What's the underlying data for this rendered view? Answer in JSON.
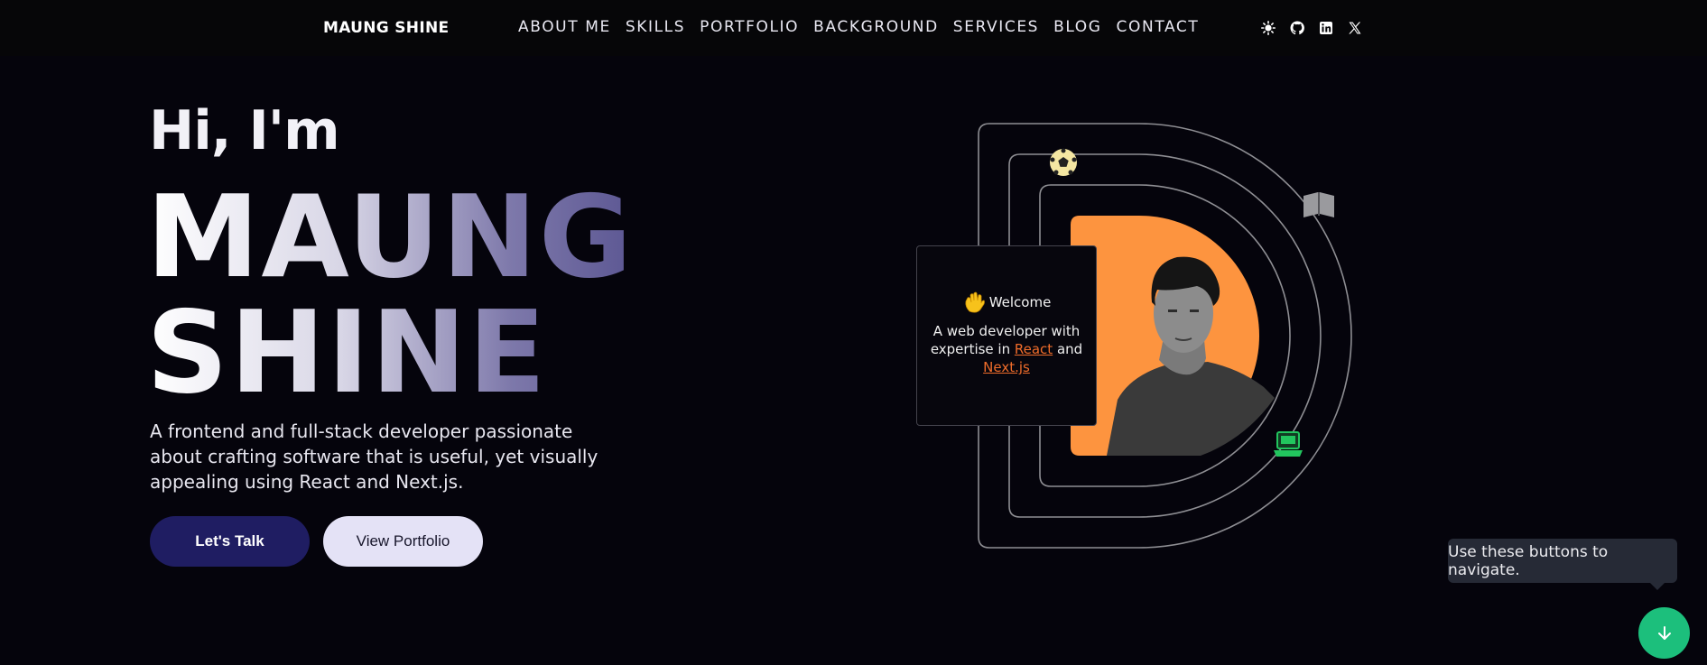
{
  "nav": {
    "brand": "MAUNG SHINE",
    "links": [
      {
        "label": "ABOUT ME"
      },
      {
        "label": "SKILLS"
      },
      {
        "label": "PORTFOLIO"
      },
      {
        "label": "BACKGROUND"
      },
      {
        "label": "SERVICES"
      },
      {
        "label": "BLOG"
      },
      {
        "label": "CONTACT"
      }
    ],
    "icons": [
      "theme-toggle-icon",
      "github-icon",
      "linkedin-icon",
      "x-icon"
    ]
  },
  "hero": {
    "greeting": "Hi, I'm",
    "name_line1": "MAUNG",
    "name_line2": "SHINE",
    "description": "A frontend and full-stack developer passionate about crafting software that is useful, yet visually appealing using React and Next.js.",
    "cta_primary": "Let's Talk",
    "cta_secondary": "View Portfolio"
  },
  "card": {
    "title": "Welcome",
    "text_before": "A web developer with expertise in ",
    "highlight1": "React",
    "text_middle": " and ",
    "highlight2": "Next.js"
  },
  "tooltip": "Use these buttons to navigate.",
  "colors": {
    "background": "#05040c",
    "accent_orange": "#fd943f",
    "primary_button": "#1f1d62",
    "secondary_button": "#e4e2f6",
    "fab_green": "#1cbf7c",
    "highlight": "#ef6c2a"
  }
}
